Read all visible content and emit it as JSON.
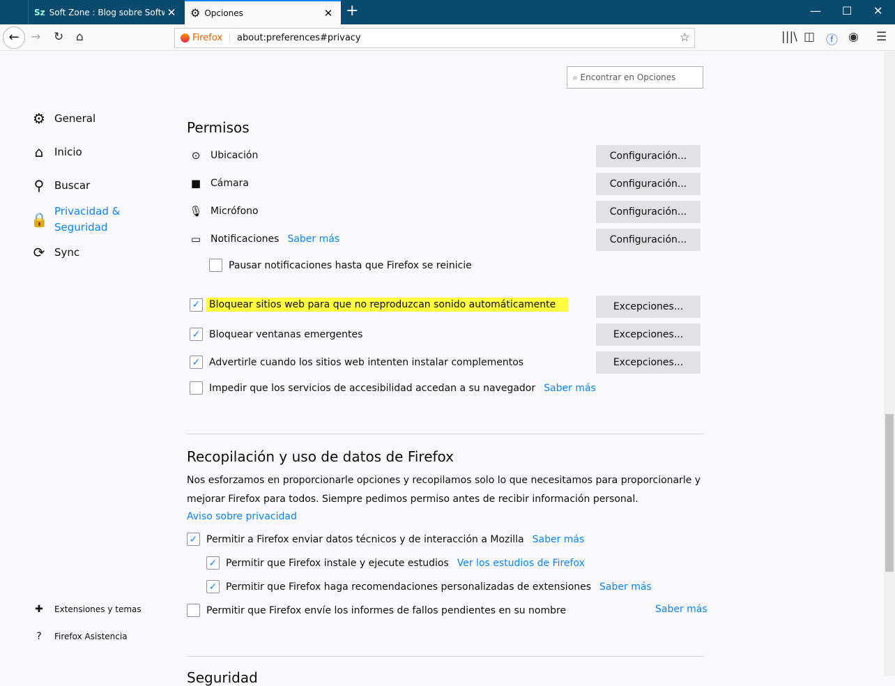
{
  "tabs": [
    {
      "label": "Soft Zone : Blog sobre Software",
      "icon": "sz-favicon"
    },
    {
      "label": "Opciones",
      "icon": "gear-icon",
      "active": true
    }
  ],
  "urlbar": {
    "identity": "Firefox",
    "url": "about:preferences#privacy"
  },
  "search": {
    "placeholder": "Encontrar en Opciones"
  },
  "sidebar": {
    "items": [
      {
        "label": "General"
      },
      {
        "label": "Inicio"
      },
      {
        "label": "Buscar"
      },
      {
        "label": "Privacidad & Seguridad",
        "line1": "Privacidad &",
        "line2": "Seguridad",
        "selected": true
      },
      {
        "label": "Sync"
      }
    ],
    "footer": [
      {
        "label": "Extensiones y temas"
      },
      {
        "label": "Firefox Asistencia"
      }
    ]
  },
  "permisos": {
    "title": "Permisos",
    "items": [
      {
        "label": "Ubicación",
        "button": "Configuración..."
      },
      {
        "label": "Cámara",
        "button": "Configuración..."
      },
      {
        "label": "Micrófono",
        "button": "Configuración..."
      },
      {
        "label": "Notificaciones",
        "link": "Saber más",
        "button": "Configuración..."
      }
    ],
    "pause": {
      "label": "Pausar notificaciones hasta que Firefox se reinicie",
      "checked": false
    },
    "checks": [
      {
        "label": "Bloquear sitios web para que no reproduzcan sonido automáticamente",
        "checked": true,
        "button": "Excepciones..."
      },
      {
        "label": "Bloquear ventanas emergentes",
        "checked": true,
        "button": "Excepciones..."
      },
      {
        "label": "Advertirle cuando los sitios web intenten instalar complementos",
        "checked": true,
        "button": "Excepciones..."
      },
      {
        "label": "Impedir que los servicios de accesibilidad accedan a su navegador",
        "checked": false,
        "link": "Saber más"
      }
    ]
  },
  "datos": {
    "title": "Recopilación y uso de datos de Firefox",
    "description": "Nos esforzamos en proporcionarle opciones y recopilamos solo lo que necesitamos para proporcionarle y mejorar Firefox para todos. Siempre pedimos permiso antes de recibir información personal.",
    "privacy_link": "Aviso sobre privacidad",
    "checks": [
      {
        "label": "Permitir a Firefox enviar datos técnicos y de interacción a Mozilla",
        "link": "Saber más",
        "checked": true
      },
      {
        "label": "Permitir que Firefox instale y ejecute estudios",
        "link": "Ver los estudios de Firefox",
        "checked": true
      },
      {
        "label": "Permitir que Firefox haga recomendaciones personalizadas de extensiones",
        "link": "Saber más",
        "checked": true
      },
      {
        "label": "Permitir que Firefox envíe los informes de fallos pendientes en su nombre",
        "link": "Saber más",
        "checked": false
      }
    ]
  },
  "next_section": "Seguridad"
}
